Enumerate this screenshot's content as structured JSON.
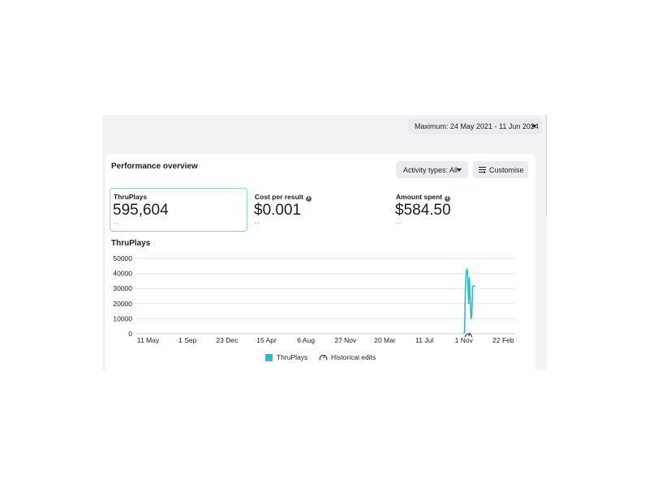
{
  "header": {
    "date_range": "Maximum: 24 May 2021 - 11 Jun 2024"
  },
  "card": {
    "title": "Performance overview",
    "activity_filter": "Activity types: All",
    "customise": "Customise"
  },
  "metrics": [
    {
      "label": "ThruPlays",
      "value": "595,604",
      "compare": "--"
    },
    {
      "label": "Cost per result",
      "value": "$0.001",
      "compare": "--"
    },
    {
      "label": "Amount spent",
      "value": "$584.50",
      "compare": "--"
    }
  ],
  "colors": {
    "series": "#27c1c8",
    "grid": "#e4e6eb",
    "selected_border": "#8fd3e6"
  },
  "chart_data": {
    "type": "line",
    "title": "ThruPlays",
    "y_ticks": [
      0,
      10000,
      20000,
      30000,
      40000,
      50000
    ],
    "ylim": [
      0,
      50000
    ],
    "x_ticks": [
      "11 May",
      "1 Sep",
      "23 Dec",
      "15 Apr",
      "6 Aug",
      "27 Nov",
      "20 Mar",
      "11 Jul",
      "1 Nov",
      "22 Feb"
    ],
    "x_range_ticks": [
      -0.3,
      9.3
    ],
    "series": [
      {
        "name": "ThruPlays",
        "points": [
          [
            8.0,
            0
          ],
          [
            8.02,
            2000
          ],
          [
            8.04,
            30000
          ],
          [
            8.06,
            41000
          ],
          [
            8.08,
            43000
          ],
          [
            8.1,
            38000
          ],
          [
            8.12,
            20000
          ],
          [
            8.14,
            37000
          ],
          [
            8.16,
            24000
          ],
          [
            8.18,
            10000
          ],
          [
            8.2,
            12000
          ],
          [
            8.22,
            31000
          ],
          [
            8.25,
            32000
          ],
          [
            8.28,
            31500
          ]
        ]
      }
    ],
    "legend": [
      "ThruPlays",
      "Historical edits"
    ],
    "grid": true
  },
  "icons": {
    "historical_edit": "gauge-edit-icon",
    "customise": "sliders-icon",
    "info": "info-icon"
  }
}
